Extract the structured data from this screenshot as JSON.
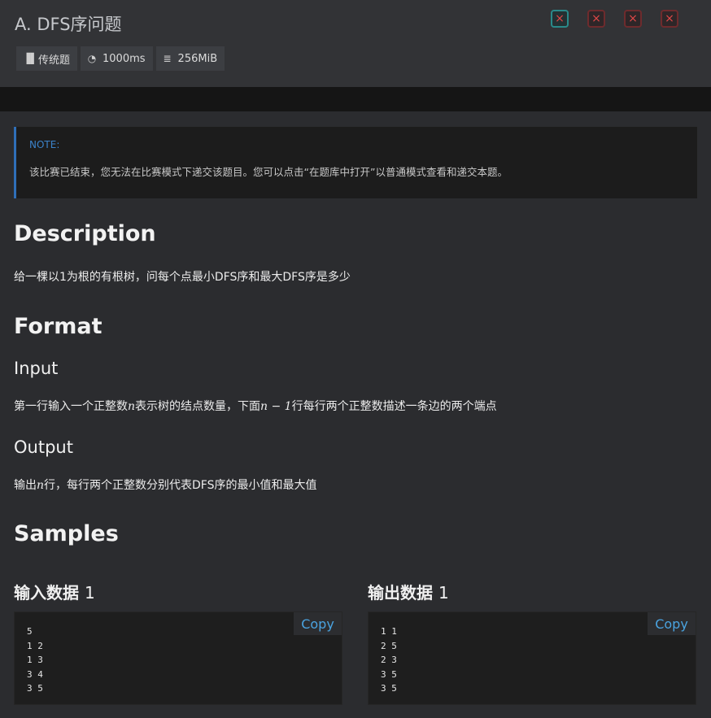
{
  "header": {
    "title": "A. DFS序问题",
    "badges": {
      "type": {
        "icon": "book-icon",
        "label": "传统题"
      },
      "time": {
        "icon": "stopwatch-icon",
        "label": "1000ms"
      },
      "memory": {
        "icon": "memory-icon",
        "label": "256MiB"
      }
    },
    "status_buttons": [
      "×",
      "×",
      "×",
      "×"
    ]
  },
  "note": {
    "label": "NOTE:",
    "text": "该比赛已结束，您无法在比赛模式下递交该题目。您可以点击“在题库中打开”以普通模式查看和递交本题。"
  },
  "description": {
    "heading": "Description",
    "text": "给一棵以1为根的有根树，问每个点最小DFS序和最大DFS序是多少"
  },
  "format": {
    "heading": "Format",
    "input_heading": "Input",
    "input_text_a": "第一行输入一个正整数",
    "input_var_n": "n",
    "input_text_b": "表示树的结点数量，下面",
    "input_expr": "n − 1",
    "input_text_c": "行每行两个正整数描述一条边的两个端点",
    "output_heading": "Output",
    "output_text_a": "输出",
    "output_var_n": "n",
    "output_text_b": "行，每行两个正整数分别代表DFS序的最小值和最大值"
  },
  "samples": {
    "heading": "Samples",
    "input": {
      "title": "输入数据",
      "index": "1",
      "content": "5\n1 2\n1 3\n3 4\n3 5",
      "copy_label": "Copy"
    },
    "output": {
      "title": "输出数据",
      "index": "1",
      "content": "1 1\n2 5\n2 3\n3 5\n3 5",
      "copy_label": "Copy"
    }
  },
  "colors": {
    "accent": "#3b82c9",
    "error": "#e04848",
    "current": "#2a8a8a"
  }
}
